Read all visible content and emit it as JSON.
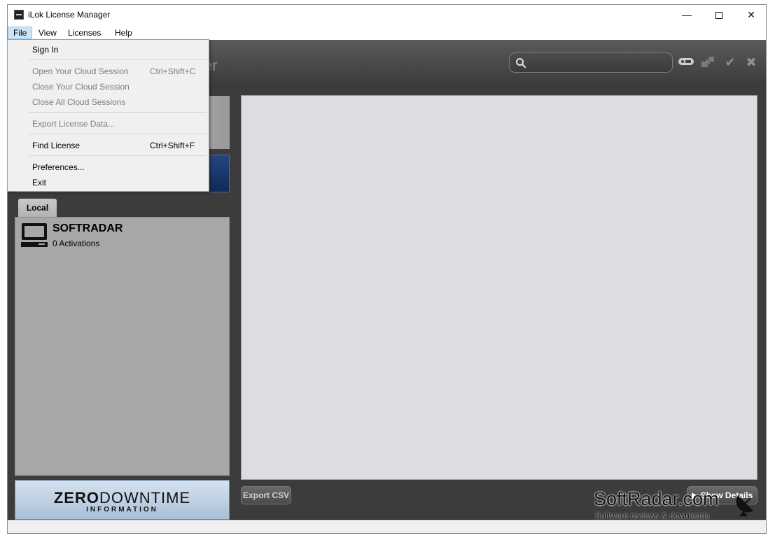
{
  "window": {
    "title": "iLok License Manager",
    "minimize_label": "—",
    "close_label": "✕"
  },
  "menubar": {
    "file": "File",
    "view": "View",
    "licenses": "Licenses",
    "help": "Help"
  },
  "file_menu": {
    "sign_in": "Sign In",
    "open_cloud": {
      "label": "Open Your Cloud Session",
      "shortcut": "Ctrl+Shift+C"
    },
    "close_cloud": "Close Your Cloud Session",
    "close_all_cloud": "Close All Cloud Sessions",
    "export_license": "Export License Data...",
    "find_license": {
      "label": "Find License",
      "shortcut": "Ctrl+Shift+F"
    },
    "preferences": "Preferences...",
    "exit": "Exit"
  },
  "header": {
    "title_fragment": "er",
    "search_placeholder": ""
  },
  "left": {
    "tab_local": "Local",
    "device": {
      "name": "SOFTRADAR",
      "activations": "0 Activations"
    }
  },
  "banner": {
    "main_bold": "ZERO",
    "main_light": "DOWNTIME",
    "sub": "INFORMATION"
  },
  "buttons": {
    "export_csv": "Export CSV",
    "show_details": "Show Details"
  },
  "watermark": {
    "logo": "SoftRadar.com",
    "tagline": "Software reviews & downloads"
  },
  "colors": {
    "header_dark": "#3c3c3c",
    "content_bg": "#dbdde1",
    "local_panel_bg": "#a5a7a9",
    "menu_highlight": "#cce4f7"
  }
}
